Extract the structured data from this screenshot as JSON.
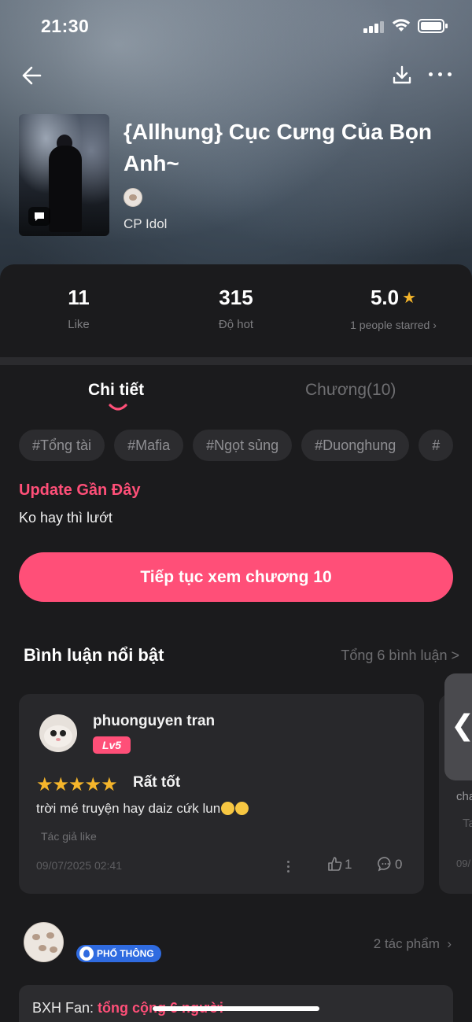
{
  "status_bar": {
    "time": "21:30"
  },
  "header": {
    "title": "{Allhung} Cục Cưng Của Bọn Anh~",
    "category": "CP Idol"
  },
  "stats": [
    {
      "value": "11",
      "label": "Like"
    },
    {
      "value": "315",
      "label": "Độ hot"
    },
    {
      "value": "5.0",
      "label": "1 people starred",
      "rating": 5.0
    }
  ],
  "tabs": {
    "detail": "Chi tiết",
    "chapters": "Chương(10)"
  },
  "tags": [
    "#Tổng tài",
    "#Mafia",
    "#Ngọt sủng",
    "#Duonghung",
    "#"
  ],
  "update": {
    "title": "Update Gần Đây",
    "text": "Ko hay thì lướt"
  },
  "cta": {
    "label": "Tiếp tục xem chương 10"
  },
  "comments": {
    "heading": "Bình luận nổi bật",
    "total": "Tổng 6 bình luận >",
    "items": [
      {
        "username": "phuonguyen tran",
        "level": "Lv5",
        "rating_stars": 5,
        "rating_text": "Rất tốt",
        "body": "trời mé truyện hay daiz cứk lun",
        "author_like": "Tác giả like",
        "date": "09/07/2025 02:41",
        "likes": "1",
        "replies": "0"
      }
    ],
    "peek": {
      "text1": "cha",
      "text2": "Ta",
      "text3": "09/"
    }
  },
  "author_section": {
    "badge": "PHỔ THÔNG",
    "works": "2 tác phẩm"
  },
  "fan_rank": {
    "label": "BXH Fan:",
    "value": "tổng cộng 6 người"
  },
  "colors": {
    "accent": "#ff4f78",
    "star": "#f5b52b",
    "background": "#1b1b1d",
    "card": "#28282b",
    "badge_blue": "#2f6be0"
  }
}
